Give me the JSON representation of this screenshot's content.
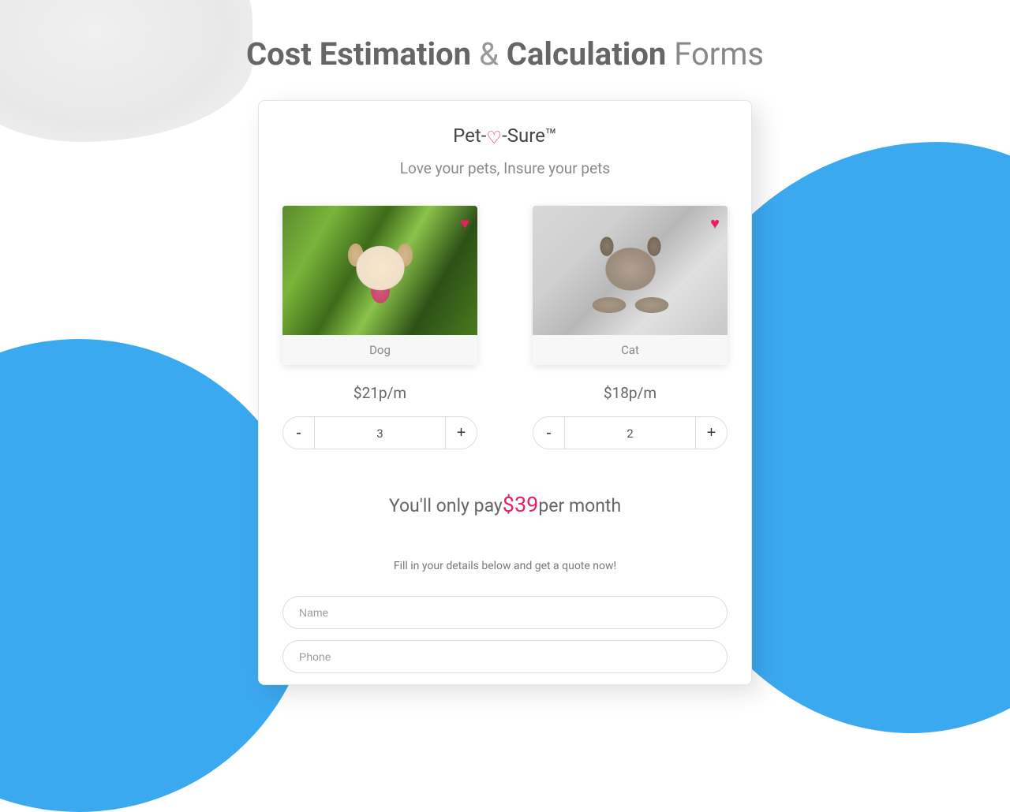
{
  "page_title": {
    "part1": "Cost Estimation",
    "amp": "&",
    "part2": "Calculation",
    "part3": "Forms"
  },
  "brand": {
    "prefix": "Pet-",
    "heart": "♡",
    "suffix": "-Sure™"
  },
  "tagline": "Love your pets, Insure your pets",
  "pets": [
    {
      "label": "Dog",
      "price": "$21p/m",
      "qty": "3",
      "img_kind": "dog"
    },
    {
      "label": "Cat",
      "price": "$18p/m",
      "qty": "2",
      "img_kind": "cat"
    }
  ],
  "stepper": {
    "minus": "-",
    "plus": "+"
  },
  "summary": {
    "prefix": "You'll only pay",
    "amount": "$39",
    "suffix": "per month"
  },
  "instruction": "Fill in your details below and get a quote now!",
  "fields": {
    "name_placeholder": "Name",
    "phone_placeholder": "Phone"
  },
  "colors": {
    "accent_pink": "#e91e63",
    "accent_blue": "#3ba9f0"
  }
}
